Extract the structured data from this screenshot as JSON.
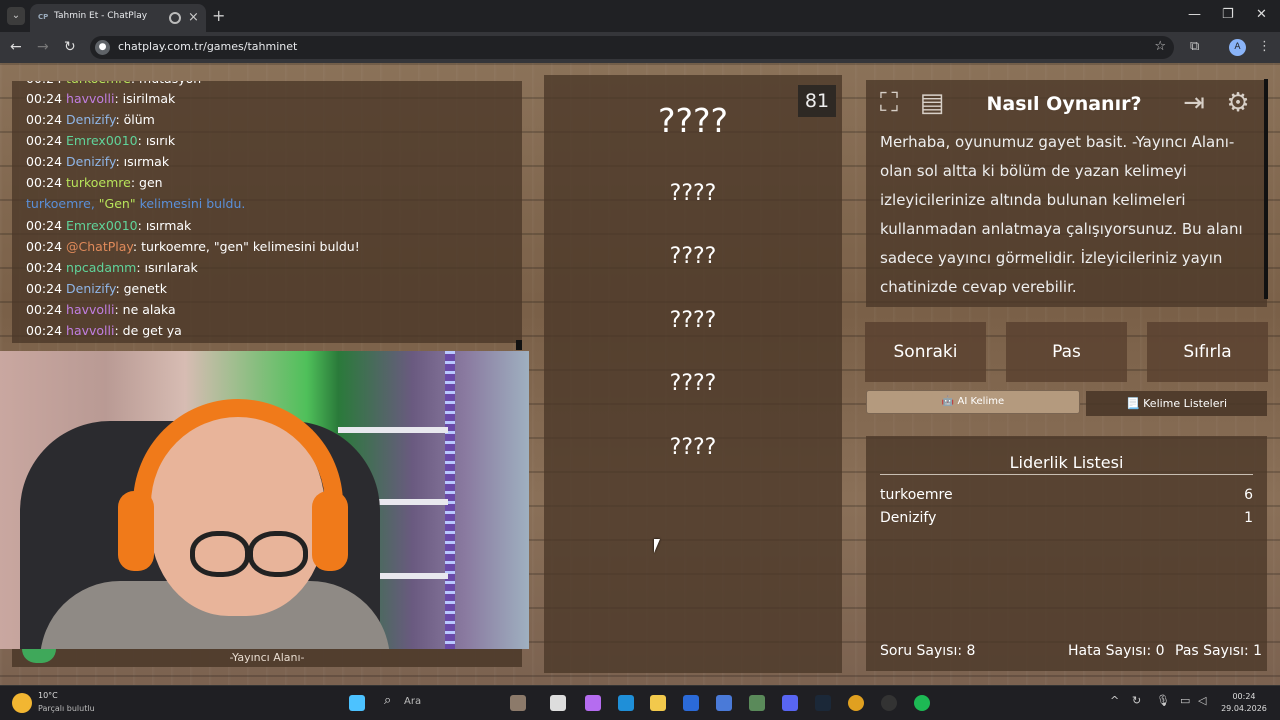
{
  "browser": {
    "tab_favicon": "CP",
    "tab_title": "Tahmin Et - ChatPlay",
    "url": "chatplay.com.tr/games/tahminet",
    "profile_initial": "A"
  },
  "chat": {
    "lines": [
      {
        "time": "00:24",
        "user": "havvolli",
        "msg": ": isirilmak"
      },
      {
        "time": "00:24",
        "user": "Denizify",
        "msg": ": ölüm"
      },
      {
        "time": "00:24",
        "user": "Emrex0010",
        "msg": ": ısırık"
      },
      {
        "time": "00:24",
        "user": "Denizify",
        "msg": ": ısırmak"
      },
      {
        "time": "00:24",
        "user": "turkoemre",
        "msg": ": gen"
      },
      {
        "system_user": "turkoemre, ",
        "system_word": "\"Gen\"",
        "system_rest": " kelimesini buldu."
      },
      {
        "time": "00:24",
        "user": "Emrex0010",
        "msg": ": ısırmak"
      },
      {
        "time": "00:24",
        "user": "@ChatPlay",
        "msg": ": turkoemre, \"gen\" kelimesini buldu!"
      },
      {
        "time": "00:24",
        "user": "npcadamm",
        "msg": ": ısırılarak"
      },
      {
        "time": "00:24",
        "user": "Denizify",
        "msg": ": genetk"
      },
      {
        "time": "00:24",
        "user": "havvolli",
        "msg": ": ne alaka"
      },
      {
        "time": "00:24",
        "user": "havvolli",
        "msg": ": de get ya"
      }
    ]
  },
  "webcam": {
    "label": "-Yayıncı Alanı-"
  },
  "game": {
    "timer": "81",
    "words": [
      "????",
      "????",
      "????",
      "????",
      "????",
      "????"
    ]
  },
  "howto": {
    "title": "Nasıl Oynanır?",
    "text": "Merhaba, oyunumuz gayet basit. -Yayıncı Alanı- olan sol altta ki bölüm de yazan kelimeyi izleyicilerinize altında bulunan kelimeleri kullanmadan anlatmaya çalışıyorsunuz. Bu alanı sadece yayıncı görmelidir. İzleyicileriniz yayın chatinizde cevap verebilir."
  },
  "controls": {
    "next": "Sonraki",
    "pass": "Pas",
    "reset": "Sıfırla",
    "ai_word": "🤖 AI Kelime",
    "word_lists": "📃 Kelime Listeleri"
  },
  "leaderboard": {
    "title": "Liderlik Listesi",
    "entries": [
      {
        "name": "turkoemre",
        "score": "6"
      },
      {
        "name": "Denizify",
        "score": "1"
      }
    ],
    "question_count": "Soru Sayısı: 8",
    "error_count": "Hata Sayısı: 0",
    "pass_count": "Pas Sayısı: 1"
  },
  "taskbar": {
    "weather_temp": "10°C",
    "weather_desc": "Parçalı bulutlu",
    "search_placeholder": "Ara",
    "time": "00:24",
    "date": "29.04.2026"
  },
  "colors": {
    "wood": "#7a6048",
    "panel": "#4a3728",
    "user_purple": "#c07ee0",
    "user_blue": "#8fb6e8",
    "user_green": "#60d39a",
    "user_lime": "#b7e35a",
    "headset_orange": "#f07a1a"
  },
  "icons": [
    "menu-icon",
    "audio-playing-icon",
    "close-icon",
    "new-tab-icon",
    "back-icon",
    "forward-icon",
    "reload-icon",
    "site-info-icon",
    "bookmark-star-icon",
    "extensions-icon",
    "more-icon",
    "fullscreen-icon",
    "wordlist-doc-icon",
    "exit-icon",
    "settings-gear-icon"
  ]
}
